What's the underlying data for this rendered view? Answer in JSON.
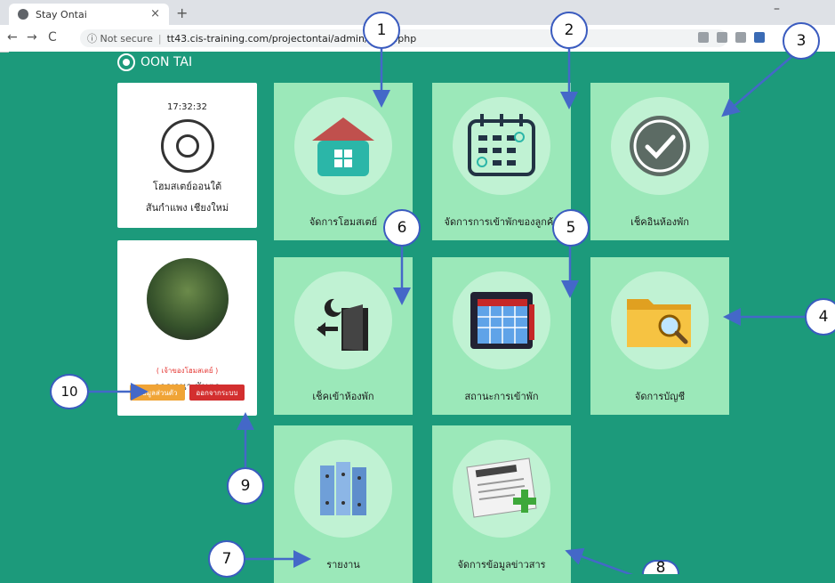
{
  "browser": {
    "tab_title": "Stay Ontai",
    "tab_close": "×",
    "new_tab": "+",
    "nav": {
      "back": "←",
      "forward": "→",
      "reload": "C"
    },
    "url_info": "ⓘ Not secure",
    "url_sep": "|",
    "url": "tt43.cis-training.com/projectontai/admin/index.php",
    "window_controls": {
      "minimize": "–"
    }
  },
  "header": {
    "logo_text": "OON TAI"
  },
  "info_card": {
    "time": "17:32:32",
    "name_line1": "โฮมสเตย์ออนใต้",
    "name_line2": "สันกำแพง เชียงใหม่"
  },
  "profile_card": {
    "role": "( เจ้าของโฮมสเตย์ )",
    "name": "กาญจนา นันตา",
    "btn_profile": "ข้อมูลส่วนตัว",
    "btn_logout": "ออกจากระบบ"
  },
  "tiles": [
    {
      "label": "จัดการโฮมสเตย์",
      "icon": "house-icon"
    },
    {
      "label": "จัดการการเข้าพักของลูกค้า",
      "icon": "calendar-icon"
    },
    {
      "label": "เช็คอินห้องพัก",
      "icon": "check-circle-icon"
    },
    {
      "label": "เช็คเข้าห้องพัก",
      "icon": "door-exit-icon"
    },
    {
      "label": "สถานะการเข้าพัก",
      "icon": "book-calendar-icon"
    },
    {
      "label": "จัดการบัญชี",
      "icon": "folder-search-icon"
    },
    {
      "label": "รายงาน",
      "icon": "binders-icon"
    },
    {
      "label": "จัดการข้อมูลข่าวสาร",
      "icon": "newspaper-add-icon"
    }
  ],
  "callouts": [
    "1",
    "2",
    "3",
    "4",
    "5",
    "6",
    "7",
    "8",
    "9",
    "10"
  ],
  "colors": {
    "background": "#1c9a7b",
    "tile": "#9be8b9",
    "tile_circle": "#c0f2d3",
    "callout_border": "#3a5bbf",
    "arrow": "#4468c8"
  }
}
